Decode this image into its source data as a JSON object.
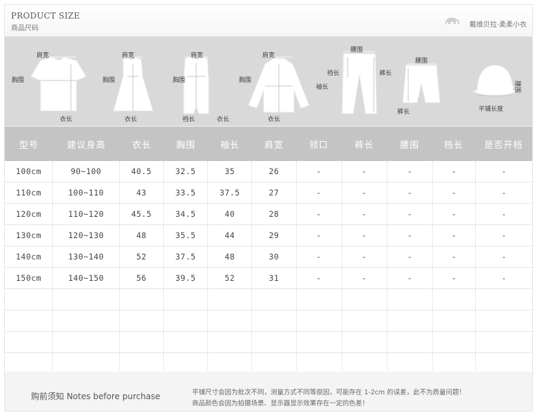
{
  "header": {
    "title_en": "PRODUCT SIZE",
    "title_cn": "商品尺码",
    "brand": "戴维贝拉·柔柔小衣"
  },
  "diagram_labels": {
    "shoulder": "肩宽",
    "chest": "胸围",
    "length": "衣长",
    "crotch": "裆长",
    "sleeve": "袖长",
    "waist": "腰围",
    "pants_length": "裤长",
    "flat_length": "平铺长度"
  },
  "table": {
    "headers": [
      "型号",
      "建议身高",
      "衣长",
      "胸围",
      "袖长",
      "肩宽",
      "领口",
      "裤长",
      "腰围",
      "档长",
      "是否开档"
    ],
    "rows": [
      [
        "100cm",
        "90~100",
        "40.5",
        "32.5",
        "35",
        "26",
        "-",
        "-",
        "-",
        "-",
        "-"
      ],
      [
        "110cm",
        "100~110",
        "43",
        "33.5",
        "37.5",
        "27",
        "-",
        "-",
        "-",
        "-",
        "-"
      ],
      [
        "120cm",
        "110~120",
        "45.5",
        "34.5",
        "40",
        "28",
        "-",
        "-",
        "-",
        "-",
        "-"
      ],
      [
        "130cm",
        "120~130",
        "48",
        "35.5",
        "44",
        "29",
        "-",
        "-",
        "-",
        "-",
        "-"
      ],
      [
        "140cm",
        "130~140",
        "52",
        "37.5",
        "48",
        "30",
        "-",
        "-",
        "-",
        "-",
        "-"
      ],
      [
        "150cm",
        "140~150",
        "56",
        "39.5",
        "52",
        "31",
        "-",
        "-",
        "-",
        "-",
        "-"
      ],
      [
        "",
        "",
        "",
        "",
        "",
        "",
        "",
        "",
        "",
        "",
        ""
      ],
      [
        "",
        "",
        "",
        "",
        "",
        "",
        "",
        "",
        "",
        "",
        ""
      ],
      [
        "",
        "",
        "",
        "",
        "",
        "",
        "",
        "",
        "",
        "",
        ""
      ],
      [
        "",
        "",
        "",
        "",
        "",
        "",
        "",
        "",
        "",
        "",
        ""
      ]
    ]
  },
  "notes": {
    "label": "购前须知 Notes before purchase",
    "line1": "平铺尺寸会因为批次不同，测量方式不同等原因，可能存在 1-2cm 的误差，此不为质量问题！",
    "line2": "商品颜色会因为拍摄场景、显示器显示效果存在一定的色差！"
  }
}
